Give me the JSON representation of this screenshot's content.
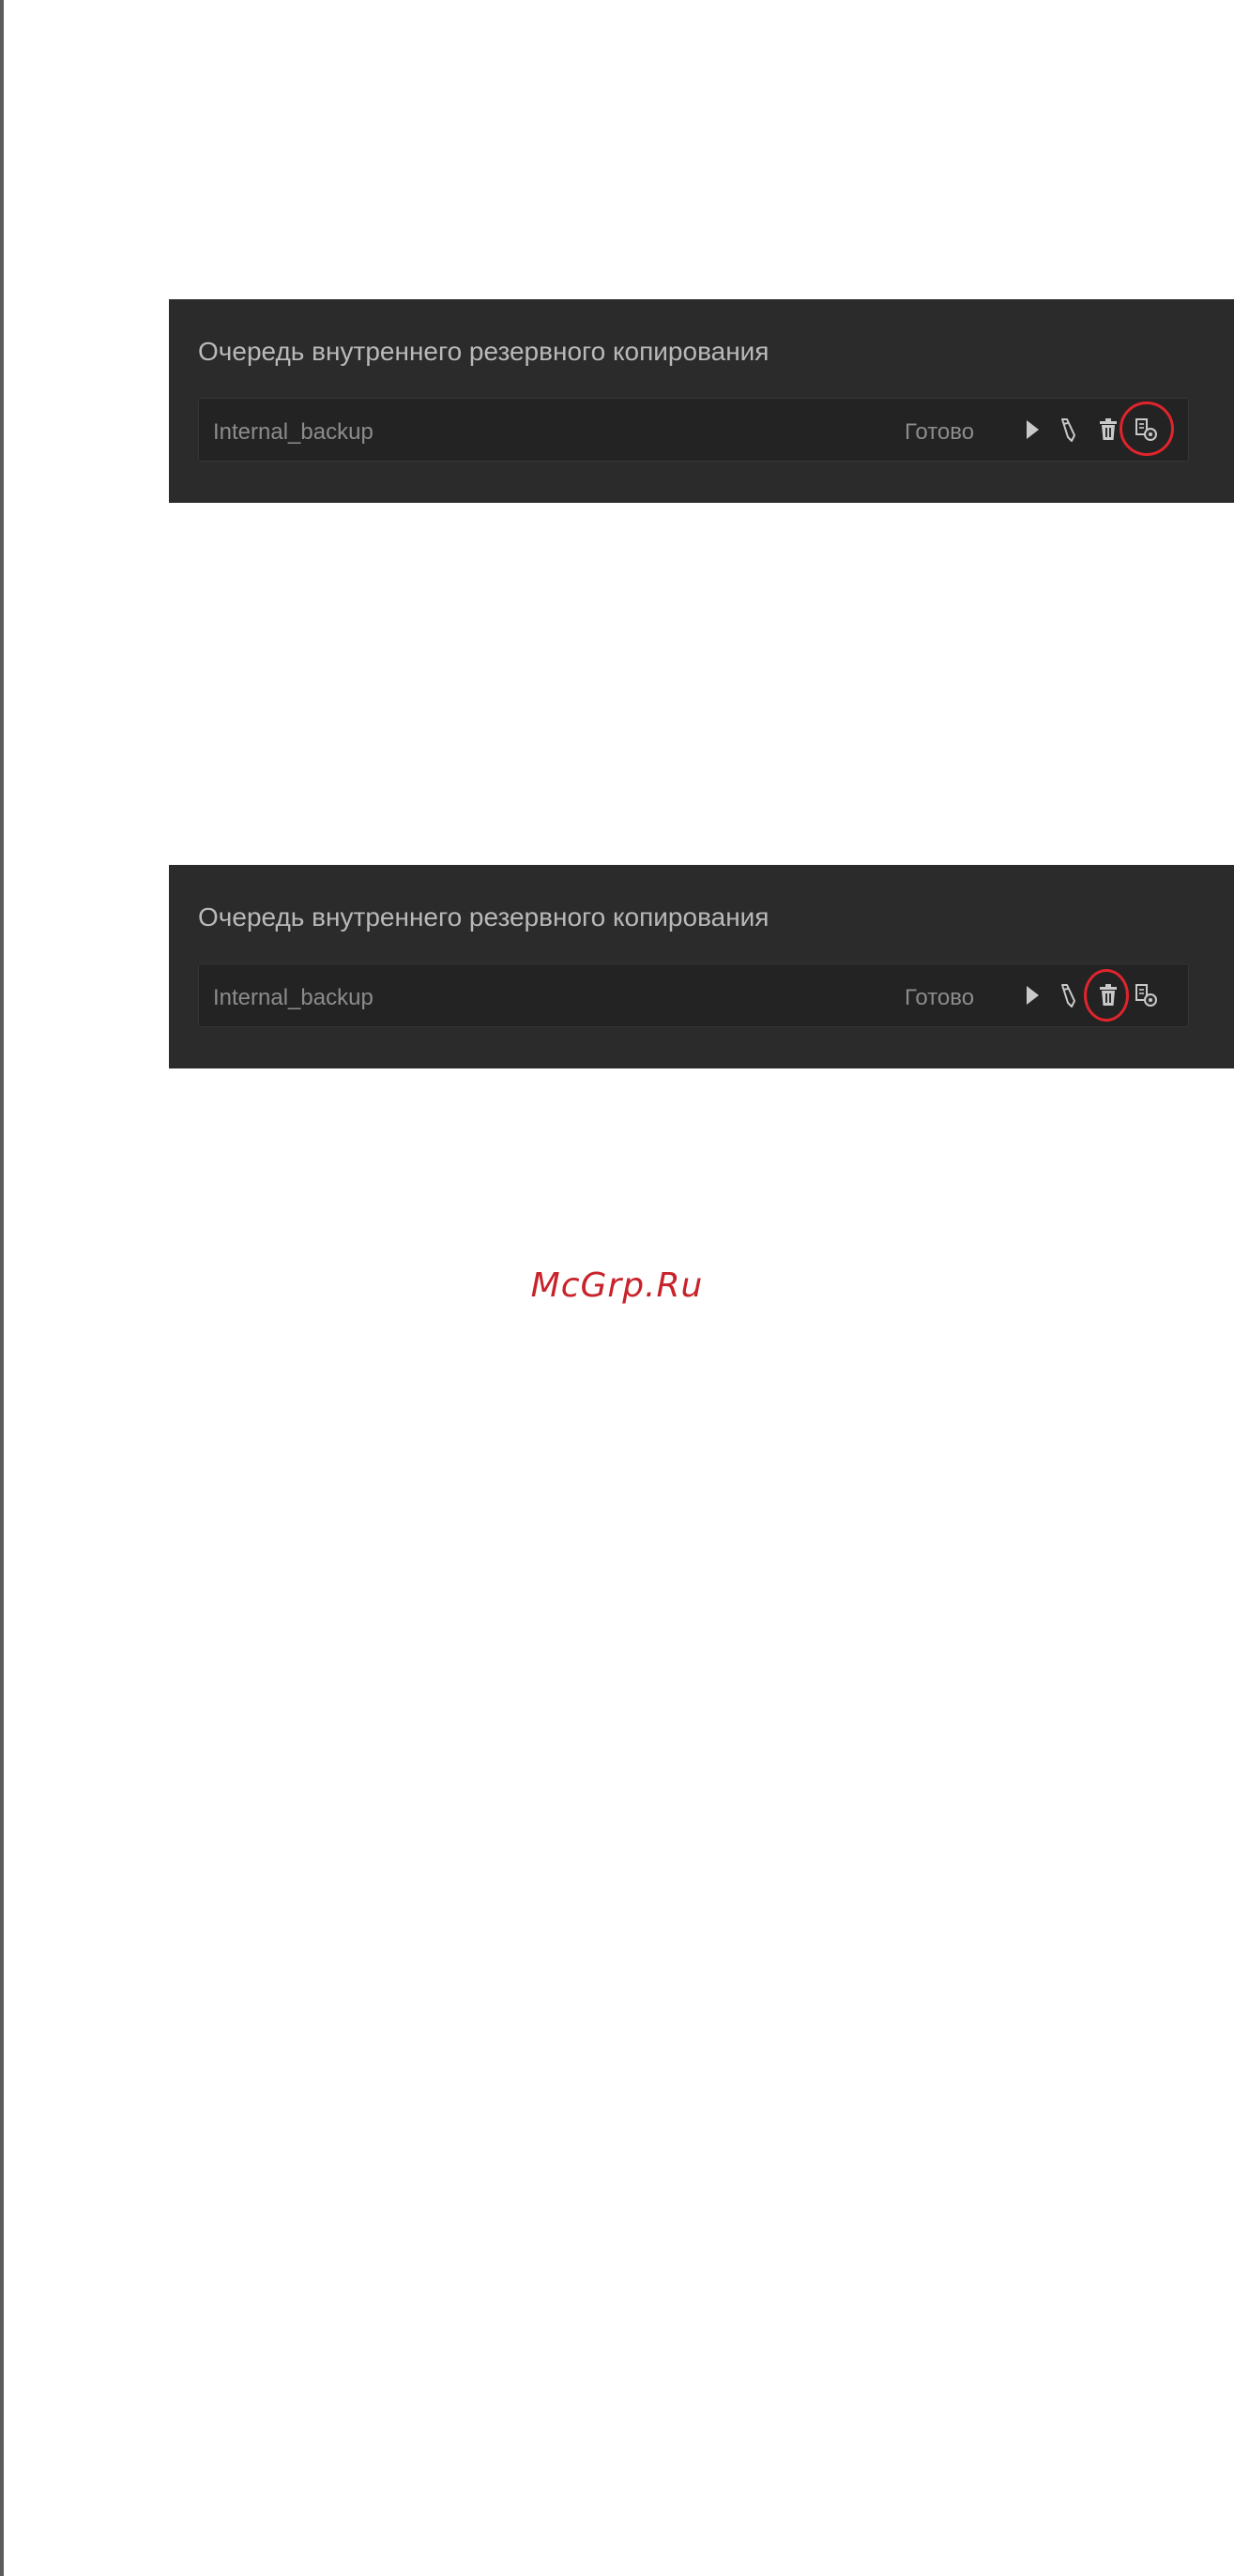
{
  "screens": [
    {
      "panel_title": "Очередь внутреннего резервного копирования",
      "job": {
        "name": "Internal_backup",
        "status": "Готово"
      },
      "highlighted_action": "restore"
    },
    {
      "panel_title": "Очередь внутреннего резервного копирования",
      "job": {
        "name": "Internal_backup",
        "status": "Готово"
      },
      "highlighted_action": "delete"
    }
  ],
  "actions": [
    "play-icon",
    "pencil-icon",
    "trash-icon",
    "restore-document-icon"
  ],
  "watermark": "McGrp.Ru",
  "colors": {
    "panel_bg": "#2b2b2b",
    "row_bg": "#232323",
    "title_text": "#b9b9b9",
    "row_text": "#8c8c8c",
    "icon": "#c9c9c9",
    "highlight": "#e0242c",
    "watermark": "#c8232a"
  }
}
